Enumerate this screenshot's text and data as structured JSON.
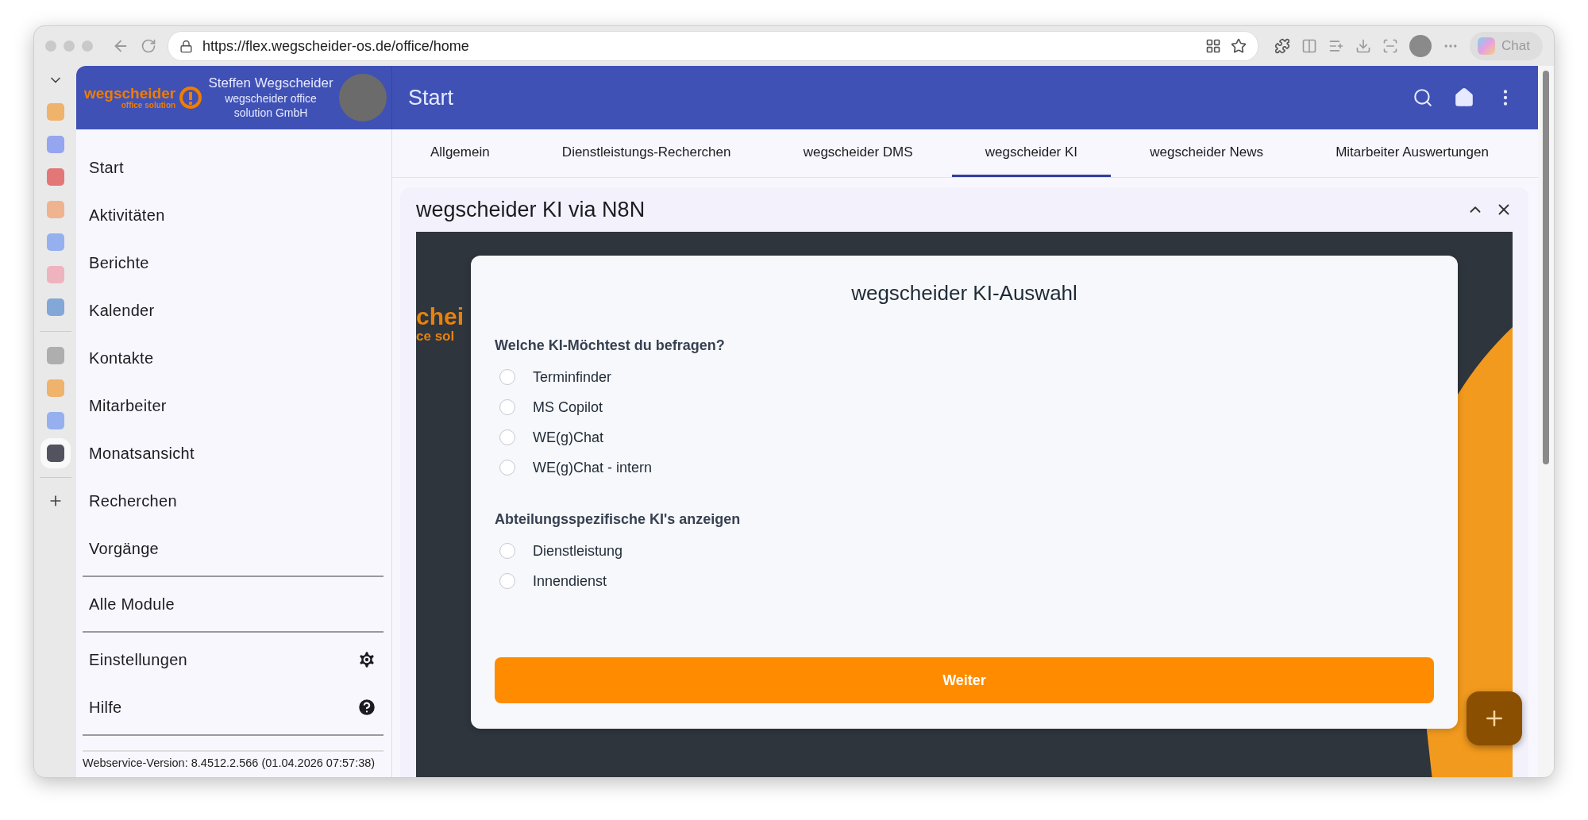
{
  "browser": {
    "url": "https://flex.wegscheider-os.de/office/home",
    "chat_label": "Chat"
  },
  "header": {
    "logo_text": "wegscheider",
    "logo_sub": "office solution",
    "user_name": "Steffen Wegscheider",
    "company": "wegscheider office solution GmbH",
    "title": "Start"
  },
  "drawer": {
    "items": [
      "Start",
      "Aktivitäten",
      "Berichte",
      "Kalender",
      "Kontakte",
      "Mitarbeiter",
      "Monatsansicht",
      "Recherchen",
      "Vorgänge"
    ],
    "modules": "Alle Module",
    "settings": "Einstellungen",
    "help": "Hilfe",
    "version": "Webservice-Version: 8.4512.2.566 (01.04.2026 07:57:38)"
  },
  "tabs": [
    {
      "label": "Allgemein",
      "selected": false
    },
    {
      "label": "Dienstleistungs-Recherchen",
      "selected": false
    },
    {
      "label": "wegscheider DMS",
      "selected": false
    },
    {
      "label": "wegscheider KI",
      "selected": true
    },
    {
      "label": "wegscheider News",
      "selected": false
    },
    {
      "label": "Mitarbeiter Auswertungen",
      "selected": false
    }
  ],
  "panel": {
    "title": "wegscheider KI via N8N",
    "background_text": [
      "chei",
      "ce sol"
    ],
    "form": {
      "title": "wegscheider KI-Auswahl",
      "groups": [
        {
          "question": "Welche KI-Möchtest du befragen?",
          "options": [
            {
              "label": "Terminfinder",
              "selected": false
            },
            {
              "label": "MS Copilot",
              "selected": false
            },
            {
              "label": "WE(g)Chat",
              "selected": false
            },
            {
              "label": "WE(g)Chat - intern",
              "selected": false
            }
          ]
        },
        {
          "question": "Abteilungsspezifische KI's anzeigen",
          "options": [
            {
              "label": "Dienstleistung",
              "selected": false
            },
            {
              "label": "Innendienst",
              "selected": false
            }
          ]
        }
      ],
      "submit": "Weiter"
    }
  }
}
